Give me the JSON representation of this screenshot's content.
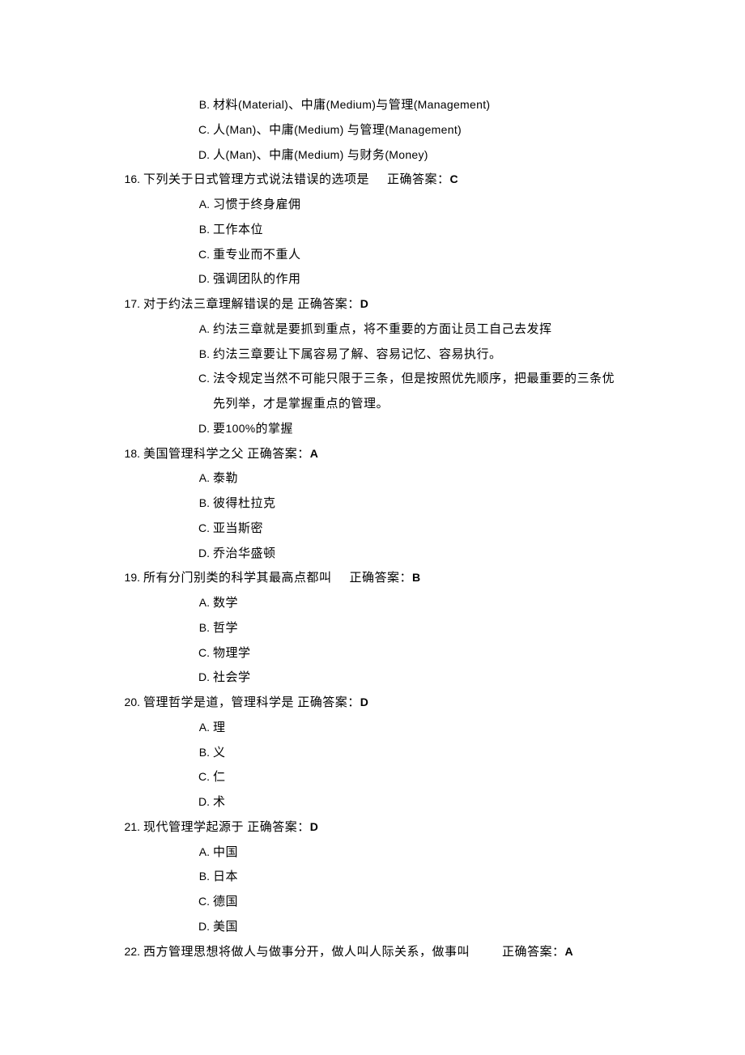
{
  "orphan_options": [
    {
      "letter": "B. ",
      "text_pre": "材料",
      "lat1": "(Material)",
      "mid1": "、中庸",
      "lat2": "(Medium)",
      "mid2": "与管理",
      "lat3": "(Management)"
    },
    {
      "letter": "C. ",
      "text_pre": "人",
      "lat1": "(Man)",
      "mid1": "、中庸",
      "lat2": "(Medium) ",
      "mid2": "与管理",
      "lat3": "(Management)"
    },
    {
      "letter": "D. ",
      "text_pre": "人",
      "lat1": "(Man)",
      "mid1": "、中庸",
      "lat2": "(Medium) ",
      "mid2": "与财务",
      "lat3": "(Money)"
    }
  ],
  "q16": {
    "num": "16. ",
    "text": "下列关于日式管理方式说法错误的选项是",
    "ans_label": "正确答案：",
    "ans": "C",
    "options": [
      {
        "letter": "A. ",
        "text": "习惯于终身雇佣"
      },
      {
        "letter": "B. ",
        "text": "工作本位"
      },
      {
        "letter": "C. ",
        "text": "重专业而不重人"
      },
      {
        "letter": "D. ",
        "text": "强调团队的作用"
      }
    ]
  },
  "q17": {
    "num": "17. ",
    "text": "对于约法三章理解错误的是 正确答案：",
    "ans": "D",
    "options": [
      {
        "letter": "A. ",
        "text": "约法三章就是要抓到重点，将不重要的方面让员工自己去发挥"
      },
      {
        "letter": "B. ",
        "text": "约法三章要让下属容易了解、容易记忆、容易执行。"
      },
      {
        "letter": "C. ",
        "text": "法令规定当然不可能只限于三条，但是按照优先顺序，把最重要的三条优",
        "cont": "先列举，才是掌握重点的管理。"
      },
      {
        "letter": "D. ",
        "text_pre": "要",
        "lat": "100%",
        "text_post": "的掌握"
      }
    ]
  },
  "q18": {
    "num": "18. ",
    "text": "美国管理科学之父 正确答案：",
    "ans": "A",
    "options": [
      {
        "letter": "A. ",
        "text": "泰勒"
      },
      {
        "letter": "B. ",
        "text": "彼得杜拉克"
      },
      {
        "letter": "C. ",
        "text": "亚当斯密"
      },
      {
        "letter": "D. ",
        "text": "乔治华盛顿"
      }
    ]
  },
  "q19": {
    "num": "19. ",
    "text": "所有分门别类的科学其最高点都叫",
    "ans_label": "正确答案：",
    "ans": "B",
    "options": [
      {
        "letter": "A. ",
        "text": "数学"
      },
      {
        "letter": "B. ",
        "text": "哲学"
      },
      {
        "letter": "C. ",
        "text": "物理学"
      },
      {
        "letter": "D. ",
        "text": "社会学"
      }
    ]
  },
  "q20": {
    "num": "20. ",
    "text": "管理哲学是道，管理科学是 正确答案：",
    "ans": "D",
    "options": [
      {
        "letter": "A. ",
        "text": "理"
      },
      {
        "letter": "B. ",
        "text": "义"
      },
      {
        "letter": "C. ",
        "text": "仁"
      },
      {
        "letter": "D. ",
        "text": "术"
      }
    ]
  },
  "q21": {
    "num": "21. ",
    "text": "现代管理学起源于 正确答案：",
    "ans": "D",
    "options": [
      {
        "letter": "A. ",
        "text": "中国"
      },
      {
        "letter": "B. ",
        "text": "日本"
      },
      {
        "letter": "C. ",
        "text": "德国"
      },
      {
        "letter": "D. ",
        "text": "美国"
      }
    ]
  },
  "q22": {
    "num": "22. ",
    "text": "西方管理思想将做人与做事分开，做人叫人际关系，做事叫",
    "ans_label": "正确答案：",
    "ans": "A"
  }
}
